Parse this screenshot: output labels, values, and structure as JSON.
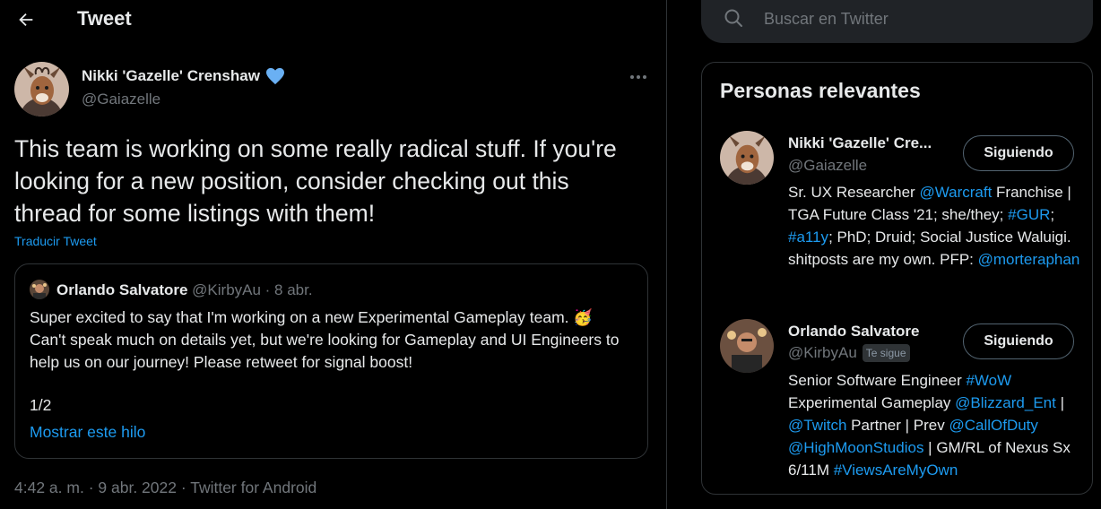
{
  "header": {
    "title": "Tweet"
  },
  "tweet": {
    "author": {
      "name": "Nikki 'Gazelle' Crenshaw",
      "handle": "@Gaiazelle"
    },
    "text": "This team is working on some really radical stuff. If you're looking for a new position, consider checking out this thread for some listings with them!",
    "translate_label": "Traducir Tweet",
    "timestamp": {
      "time": "4:42 a. m.",
      "separator": " · ",
      "date": "9 abr. 2022",
      "source": "Twitter for Android"
    }
  },
  "quote": {
    "name": "Orlando Salvatore",
    "meta": " @KirbyAu · 8 abr.",
    "line1": "Super excited to say that I'm working on a new Experimental Gameplay team. 🥳",
    "line2": "Can't speak much on details yet, but we're looking for Gameplay and UI Engineers to help us on our journey! Please retweet for signal boost!",
    "count": "1/2",
    "thread_link": "Mostrar este hilo"
  },
  "search": {
    "placeholder": "Buscar en Twitter"
  },
  "sidebar": {
    "title": "Personas relevantes",
    "people": [
      {
        "name": "Nikki 'Gazelle' Cre...",
        "handle": "@Gaiazelle",
        "button": "Siguiendo",
        "bio": [
          {
            "t": "Sr. UX Researcher "
          },
          {
            "t": "@Warcraft",
            "link": true
          },
          {
            "t": " Franchise | TGA Future Class '21; she/they; "
          },
          {
            "t": "#GUR",
            "link": true
          },
          {
            "t": "; "
          },
          {
            "t": "#a11y",
            "link": true
          },
          {
            "t": "; PhD; Druid; Social Justice Waluigi. shitposts are my own. PFP: "
          },
          {
            "t": "@morteraphan",
            "link": true
          }
        ]
      },
      {
        "name": "Orlando Salvatore",
        "handle": "@KirbyAu",
        "badge": "Te sigue",
        "button": "Siguiendo",
        "bio": [
          {
            "t": "Senior Software Engineer "
          },
          {
            "t": "#WoW",
            "link": true
          },
          {
            "t": " Experimental Gameplay "
          },
          {
            "t": "@Blizzard_Ent",
            "link": true
          },
          {
            "t": " | "
          },
          {
            "t": "@Twitch",
            "link": true
          },
          {
            "t": " Partner | Prev "
          },
          {
            "t": "@CallOfDuty",
            "link": true
          },
          {
            "t": " "
          },
          {
            "t": "@HighMoonStudios",
            "link": true
          },
          {
            "t": " | GM/RL of Nexus Sx 6/11M "
          },
          {
            "t": "#ViewsAreMyOwn",
            "link": true
          }
        ]
      }
    ]
  },
  "colors": {
    "background": "#000000",
    "text": "#e7e9ea",
    "secondary": "#71767b",
    "accent": "#1d9bf0",
    "verified": "#6ab0f3",
    "border": "#2f3336"
  }
}
